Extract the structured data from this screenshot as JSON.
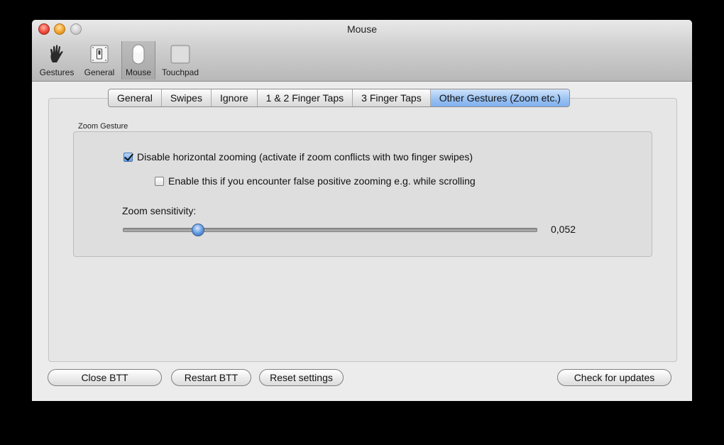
{
  "window": {
    "title": "Mouse"
  },
  "toolbar": {
    "items": [
      {
        "label": "Gestures",
        "icon": "hand-icon"
      },
      {
        "label": "General",
        "icon": "switch-icon"
      },
      {
        "label": "Mouse",
        "icon": "mouse-icon",
        "selected": true
      },
      {
        "label": "Touchpad",
        "icon": "touchpad-icon"
      }
    ]
  },
  "tabs": {
    "items": [
      {
        "label": "General"
      },
      {
        "label": "Swipes"
      },
      {
        "label": "Ignore"
      },
      {
        "label": "1 & 2 Finger Taps"
      },
      {
        "label": "3 Finger Taps"
      },
      {
        "label": "Other Gestures (Zoom etc.)",
        "active": true
      }
    ]
  },
  "zoom_group": {
    "title": "Zoom Gesture",
    "disable_horizontal": {
      "label": "Disable horizontal zooming (activate if zoom conflicts with two finger swipes)",
      "checked": true
    },
    "false_positive": {
      "label": "Enable this if you encounter false positive zooming e.g. while scrolling",
      "checked": false
    },
    "sensitivity": {
      "label": "Zoom sensitivity:",
      "value_text": "0,052",
      "fraction": 0.18
    }
  },
  "buttons": {
    "close": "Close BTT",
    "restart": "Restart BTT",
    "reset": "Reset settings",
    "updates": "Check for updates"
  },
  "colors": {
    "accent": "#7fb0ee",
    "knob": "#5d97df",
    "close_light": "#ee4b3c",
    "minimize_light": "#f2a32c"
  }
}
